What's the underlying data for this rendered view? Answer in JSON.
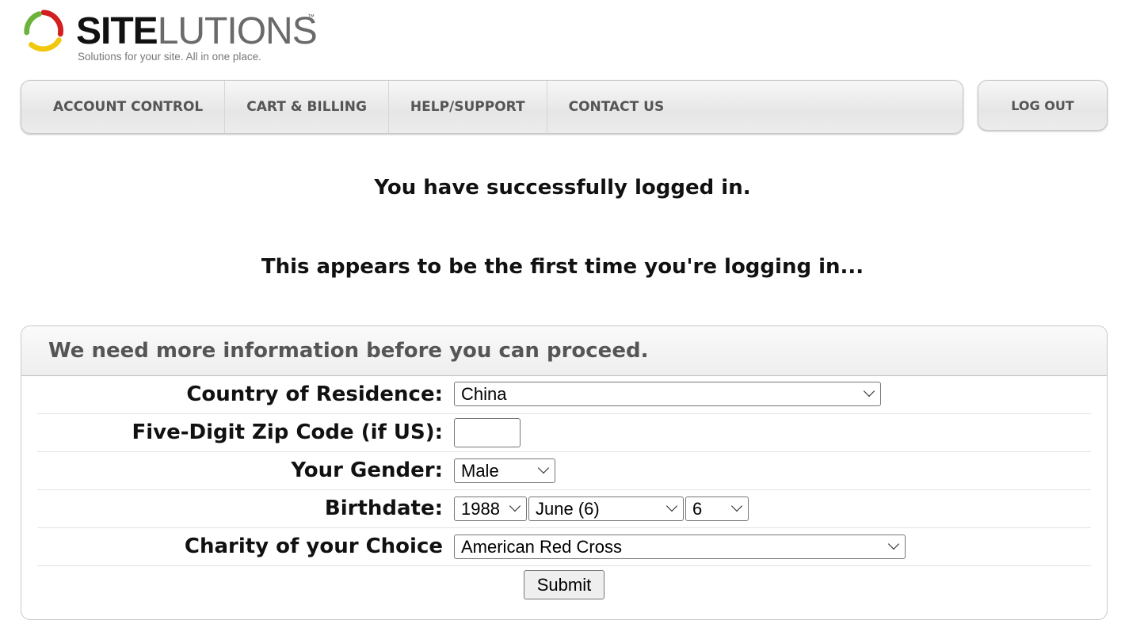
{
  "brand": {
    "name_bold": "SITE",
    "name_light": "LUTIONS",
    "trademark": "™",
    "tagline": "Solutions for your site. All in one place."
  },
  "nav": {
    "items": [
      {
        "label": "ACCOUNT CONTROL"
      },
      {
        "label": "CART & BILLING"
      },
      {
        "label": "HELP/SUPPORT"
      },
      {
        "label": "CONTACT US"
      }
    ],
    "logout_label": "LOG OUT"
  },
  "messages": {
    "success": "You have successfully logged in.",
    "first_time": "This appears to be the first time you're logging in..."
  },
  "form": {
    "heading": "We need more information before you can proceed.",
    "country": {
      "label": "Country of Residence:",
      "value": "China"
    },
    "zip": {
      "label": "Five-Digit Zip Code (if US):",
      "value": ""
    },
    "gender": {
      "label": "Your Gender:",
      "value": "Male"
    },
    "birthdate": {
      "label": "Birthdate:",
      "year": "1988",
      "month": "June (6)",
      "day": "6"
    },
    "charity": {
      "label": "Charity of your Choice",
      "value": "American Red Cross"
    },
    "submit_label": "Submit"
  }
}
